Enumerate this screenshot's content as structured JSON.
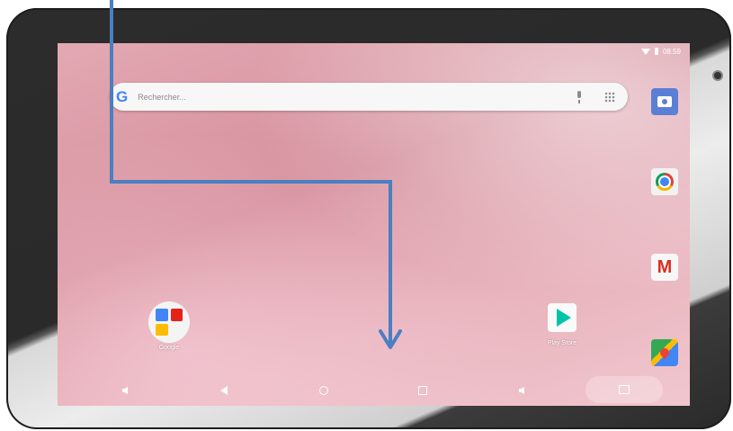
{
  "status_bar": {
    "time": "08:59",
    "icons": [
      "wifi-icon",
      "battery-icon"
    ]
  },
  "search_bar": {
    "logo": "G",
    "placeholder": "Rechercher..."
  },
  "side_dock": [
    {
      "name": "camera-app",
      "icon": "camera-icon"
    },
    {
      "name": "chrome-app",
      "icon": "chrome-icon"
    },
    {
      "name": "gmail-app",
      "icon": "gmail-icon"
    },
    {
      "name": "maps-app",
      "icon": "maps-icon"
    }
  ],
  "gmail": {
    "letter": "M"
  },
  "home_icons": {
    "google_folder_label": "Google",
    "playstore_label": "Play Store"
  },
  "nav_bar": {
    "buttons": [
      "volume-down-icon",
      "back-icon",
      "home-icon",
      "recents-icon",
      "volume-up-icon",
      "screenshot-icon"
    ]
  },
  "colors": {
    "arrow": "#4a7fc1",
    "wallpaper": "#d58f9c",
    "tablet_frame": "#2c2c2c"
  }
}
